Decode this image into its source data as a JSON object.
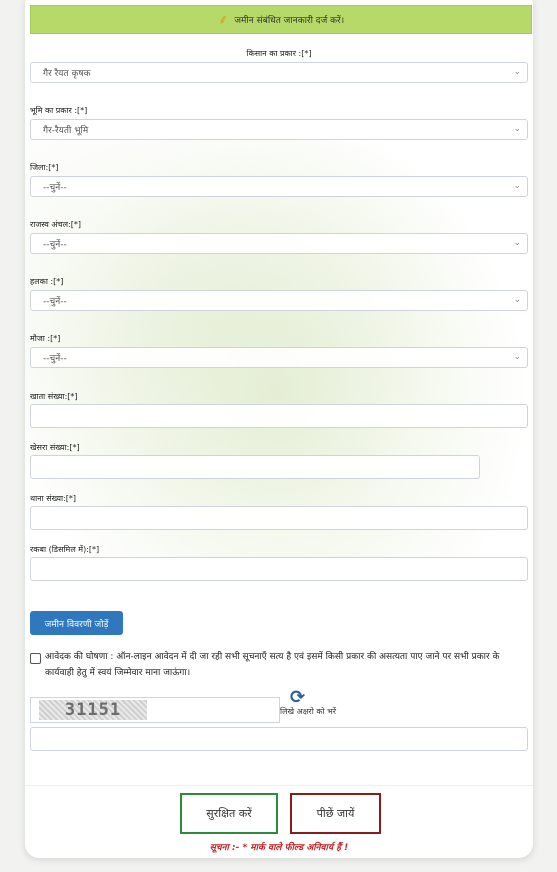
{
  "banner": {
    "icon": "wheat-icon",
    "title": "जमीन संबंधित जानकारी दर्ज करें।"
  },
  "fields": {
    "farmer_type": {
      "label": "किसान का प्रकार :[*]",
      "value": "गैर रैयत कृषक"
    },
    "land_type": {
      "label": "भूमि का प्रकार :[*]",
      "value": "गैर-रैयती भूमि"
    },
    "district": {
      "label": "जिला:[*]",
      "value": "--चुनें--"
    },
    "circle": {
      "label": "राजस्व अंचल:[*]",
      "value": "--चुनें--"
    },
    "halka": {
      "label": "हलका :[*]",
      "value": "--चुनें--"
    },
    "mauza": {
      "label": "मौजा :[*]",
      "value": "--चुनें--"
    },
    "khata_no": {
      "label": "खाता संख्या:[*]",
      "value": ""
    },
    "khesra_no": {
      "label": "खेसरा संख्या:[*]",
      "value": ""
    },
    "thana_no": {
      "label": "थाना संख्या:[*]",
      "value": ""
    },
    "rakwa": {
      "label": "रकबा (डिसमिल में):[*]",
      "value": ""
    }
  },
  "add_button": "जमीन विवरणी जोड़ें",
  "declaration": "आवेदक की घोषणा : ऑन-लाइन आवेदन में दी जा रही सभी सूचनाएँ सत्य है एवं इसमें किसी प्रकार की असत्यता पाए जाने पर सभी प्रकार के कार्यवाही हेतु में स्वयं जिम्मेवार माना जाऊंगा।",
  "captcha": {
    "code": "31151",
    "hint": "लिखे अक्षरो को भरें",
    "value": ""
  },
  "actions": {
    "save": "सुरक्षित करें",
    "back": "पीछें जायें"
  },
  "notice": "सूचना :- * मार्क वाले फील्ड अनिवार्य हैं !",
  "colors": {
    "banner": "#b7d96a",
    "primary": "#2f78bd",
    "save_border": "#2e8b3a",
    "back_border": "#8b1c1c",
    "notice": "#c0282b"
  }
}
